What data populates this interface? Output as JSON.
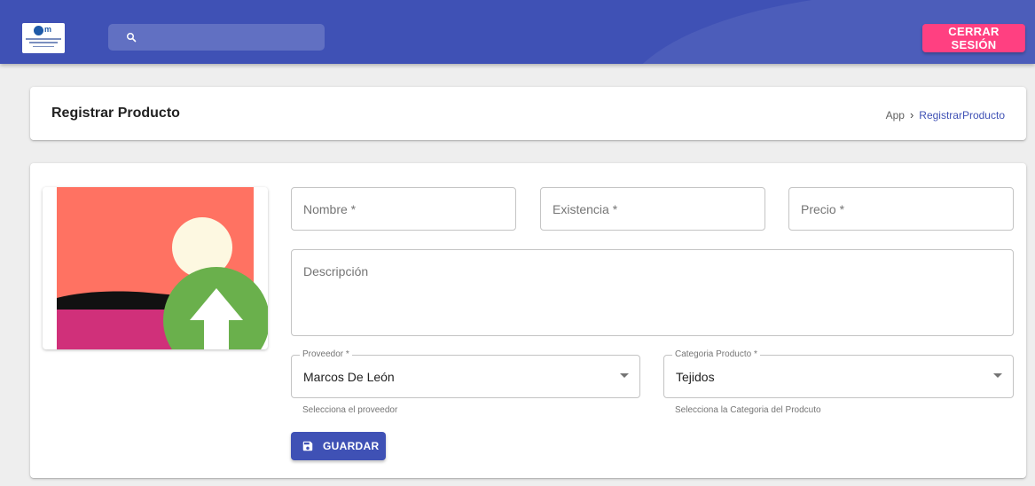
{
  "topbar": {
    "search_placeholder": "",
    "logout_label": "CERRAR SESIÓN",
    "logo_mark": "m"
  },
  "header": {
    "title": "Registrar Producto",
    "breadcrumb": [
      "App",
      "RegistrarProducto"
    ]
  },
  "form": {
    "nombre_placeholder": "Nombre *",
    "existencia_placeholder": "Existencia *",
    "precio_placeholder": "Precio *",
    "descripcion_placeholder": "Descripción",
    "proveedor": {
      "label": "Proveedor *",
      "value": "Marcos De León",
      "helper": "Selecciona el proveedor"
    },
    "categoria": {
      "label": "Categoria Producto *",
      "value": "Tejidos",
      "helper": "Selecciona la Categoria del Prodcuto"
    },
    "save_label": "GUARDAR"
  },
  "icons": {
    "search": "search-icon",
    "save": "save-icon",
    "upload": "upload-image-icon",
    "dropdown": "chevron-down-icon"
  },
  "colors": {
    "primary": "#3f51b5",
    "accent": "#ff4081",
    "background": "#eeeeee"
  }
}
